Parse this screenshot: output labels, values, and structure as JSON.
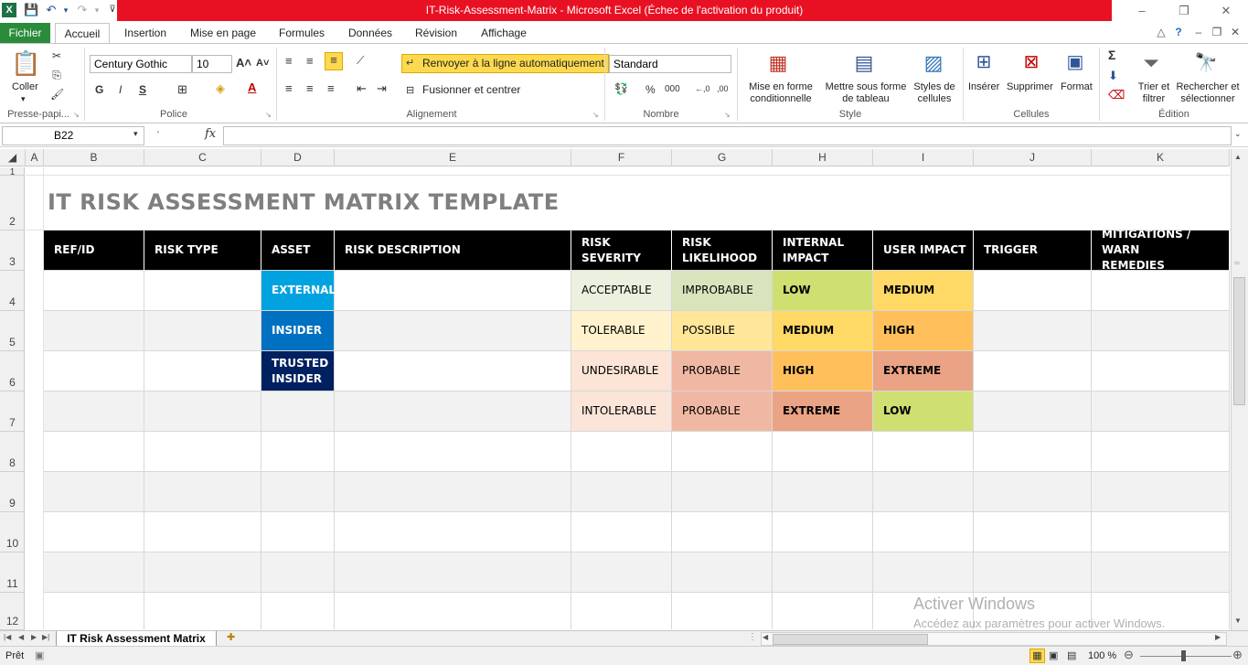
{
  "window": {
    "title": "IT-Risk-Assessment-Matrix  -  Microsoft Excel (Échec de l'activation du produit)",
    "minimize": "–",
    "restore": "❐",
    "close": "✕"
  },
  "ribbon_tabs": {
    "file": "Fichier",
    "items": [
      "Accueil",
      "Insertion",
      "Mise en page",
      "Formules",
      "Données",
      "Révision",
      "Affichage"
    ]
  },
  "ribbon": {
    "clipboard": {
      "paste": "Coller",
      "label": "Presse-papi..."
    },
    "font": {
      "name": "Century Gothic",
      "size": "10",
      "bold": "G",
      "italic": "I",
      "underline": "S",
      "label": "Police"
    },
    "alignment": {
      "wrap": "Renvoyer à la ligne automatiquement",
      "merge": "Fusionner et centrer",
      "label": "Alignement"
    },
    "number": {
      "format": "Standard",
      "percent": "%",
      "thousands": "000",
      "label": "Nombre"
    },
    "style": {
      "conditional": "Mise en forme\nconditionnelle",
      "table": "Mettre sous forme\nde tableau",
      "cellstyles": "Styles de\ncellules",
      "label": "Style"
    },
    "cells": {
      "insert": "Insérer",
      "delete": "Supprimer",
      "format": "Format",
      "label": "Cellules"
    },
    "editing": {
      "sort": "Trier et\nfiltrer",
      "find": "Rechercher et\nsélectionner",
      "label": "Édition"
    }
  },
  "formula_bar": {
    "name_box": "B22",
    "fx": "fx",
    "value": ""
  },
  "columns": [
    "A",
    "B",
    "C",
    "D",
    "E",
    "F",
    "G",
    "H",
    "I",
    "J",
    "K"
  ],
  "rows": [
    "1",
    "2",
    "3",
    "4",
    "5",
    "6",
    "7",
    "8",
    "9",
    "10",
    "11",
    "12"
  ],
  "sheet": {
    "title": "IT RISK ASSESSMENT MATRIX TEMPLATE",
    "headers": [
      "REF/ID",
      "RISK TYPE",
      "ASSET",
      "RISK DESCRIPTION",
      "RISK SEVERITY",
      "RISK\nLIKELIHOOD",
      "INTERNAL\nIMPACT",
      "USER IMPACT",
      "TRIGGER",
      "MITIGATIONS / WARN\nREMEDIES"
    ],
    "assets": [
      "EXTERNAL",
      "INSIDER",
      "TRUSTED\nINSIDER"
    ],
    "severity": [
      "ACCEPTABLE",
      "TOLERABLE",
      "UNDESIRABLE",
      "INTOLERABLE"
    ],
    "likelihood": [
      "IMPROBABLE",
      "POSSIBLE",
      "PROBABLE",
      "PROBABLE"
    ],
    "internal_impact": [
      "LOW",
      "MEDIUM",
      "HIGH",
      "EXTREME"
    ],
    "user_impact": [
      "MEDIUM",
      "HIGH",
      "EXTREME",
      "LOW"
    ]
  },
  "colors": {
    "excel_green": "#2a8c3b",
    "title_red": "#e81123",
    "asset_external": "#00a3e0",
    "asset_insider": "#0070c0",
    "asset_trusted": "#002060",
    "sev": [
      "#ebf1de",
      "#fff2cc",
      "#fce4d6",
      "#fbe4d8"
    ],
    "lik": [
      "#d8e4bc",
      "#ffe699",
      "#f0b8a2",
      "#f0b8a2"
    ],
    "impact_low": "#cfdf72",
    "impact_medium": "#ffd966",
    "impact_high": "#ffc05c",
    "impact_extreme": "#eba385"
  },
  "sheet_tabs": {
    "active": "IT Risk Assessment Matrix"
  },
  "status": {
    "ready": "Prêt",
    "zoom": "100 %"
  },
  "watermark": {
    "line1": "Activer Windows",
    "line2": "Accédez aux paramètres pour activer Windows."
  }
}
